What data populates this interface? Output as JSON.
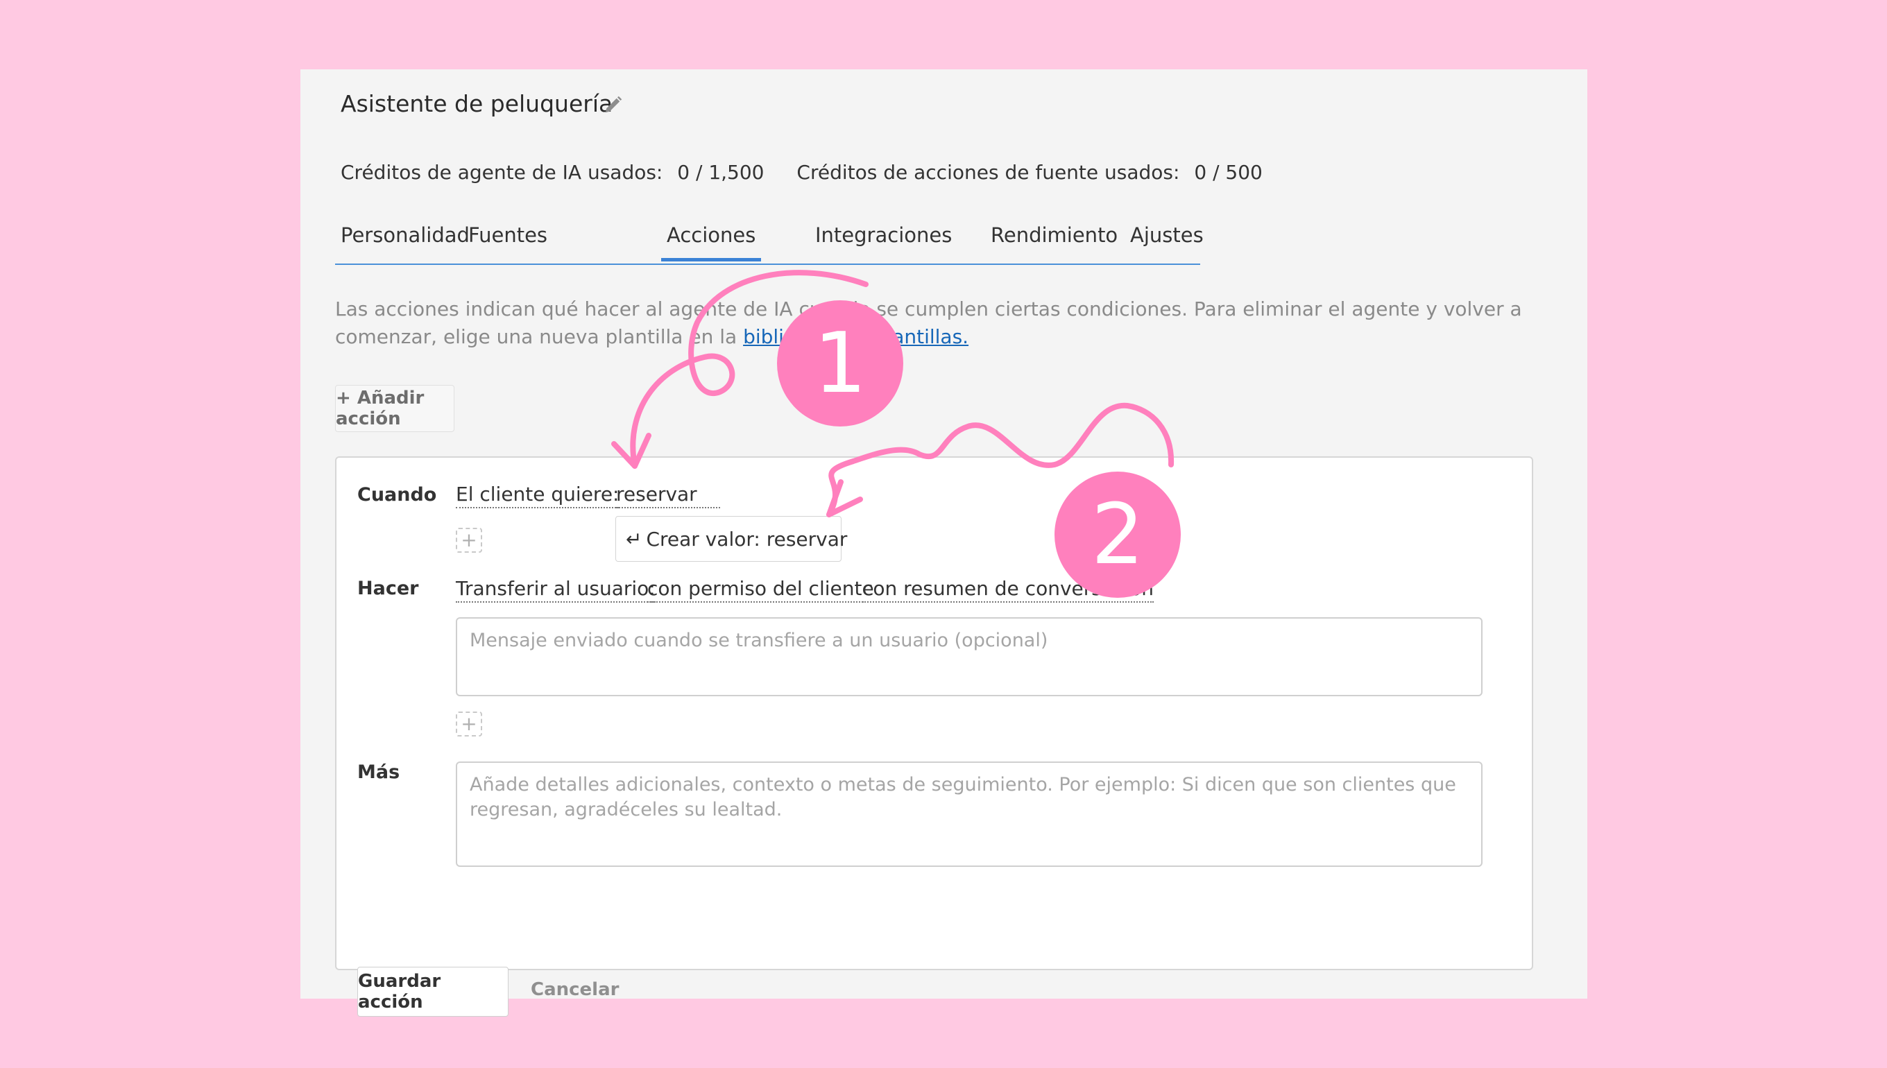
{
  "agent": {
    "title": "Asistente de peluquería"
  },
  "credits": {
    "ai_label": "Créditos de agente de IA usados:",
    "ai_value": "0 / 1,500",
    "source_label": "Créditos de acciones de fuente usados:",
    "source_value": "0 / 500"
  },
  "tabs": [
    {
      "label": "Personalidad"
    },
    {
      "label": "Fuentes"
    },
    {
      "label": "Acciones",
      "active": true
    },
    {
      "label": "Integraciones"
    },
    {
      "label": "Rendimiento"
    },
    {
      "label": "Ajustes"
    }
  ],
  "description": {
    "text": "Las acciones indican qué hacer al agente de IA cuando se cumplen ciertas condiciones. Para eliminar el agente y volver a comenzar, elige una nueva plantilla en la ",
    "link": "biblioteca de plantillas."
  },
  "add_action_label": "+ Añadir acción",
  "action_form": {
    "when_label": "Cuando",
    "when_condition": "El cliente quiere:",
    "when_value": "reservar",
    "suggestion": "Crear valor: reservar",
    "do_label": "Hacer",
    "do_action": "Transferir al usuario:",
    "do_permission": "con permiso del cliente",
    "do_summary": "con resumen de conversación",
    "message_placeholder": "Mensaje enviado cuando se transfiere a un usuario (opcional)",
    "more_label": "Más",
    "more_placeholder": "Añade detalles adicionales, contexto o metas de seguimiento. Por ejemplo: Si dicen que son clientes que regresan, agradéceles su lealtad.",
    "save_label": "Guardar acción",
    "cancel_label": "Cancelar"
  },
  "annotations": {
    "badge_1": "1",
    "badge_2": "2",
    "color": "#ff80bd"
  }
}
